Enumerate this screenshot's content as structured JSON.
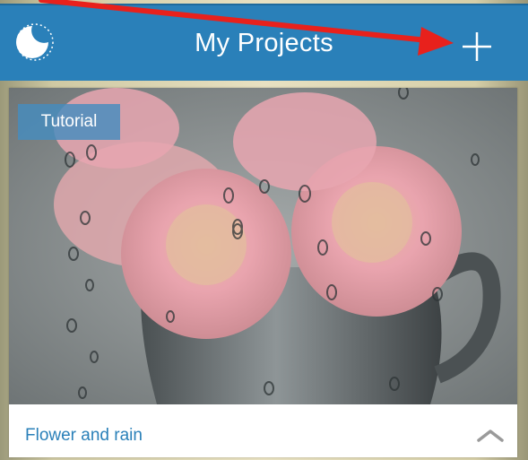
{
  "header": {
    "title": "My Projects",
    "background": "#2a80b9",
    "logo_icon": "adobe-capture-logo-icon",
    "add_icon": "plus-icon"
  },
  "annotation": {
    "arrow_color": "#e8211c"
  },
  "project_card": {
    "badge": "Tutorial",
    "name": "Flower and rain",
    "image_description": "pink-roses-in-metal-pitcher-with-raindrops",
    "expand_icon": "chevron-up-icon"
  }
}
